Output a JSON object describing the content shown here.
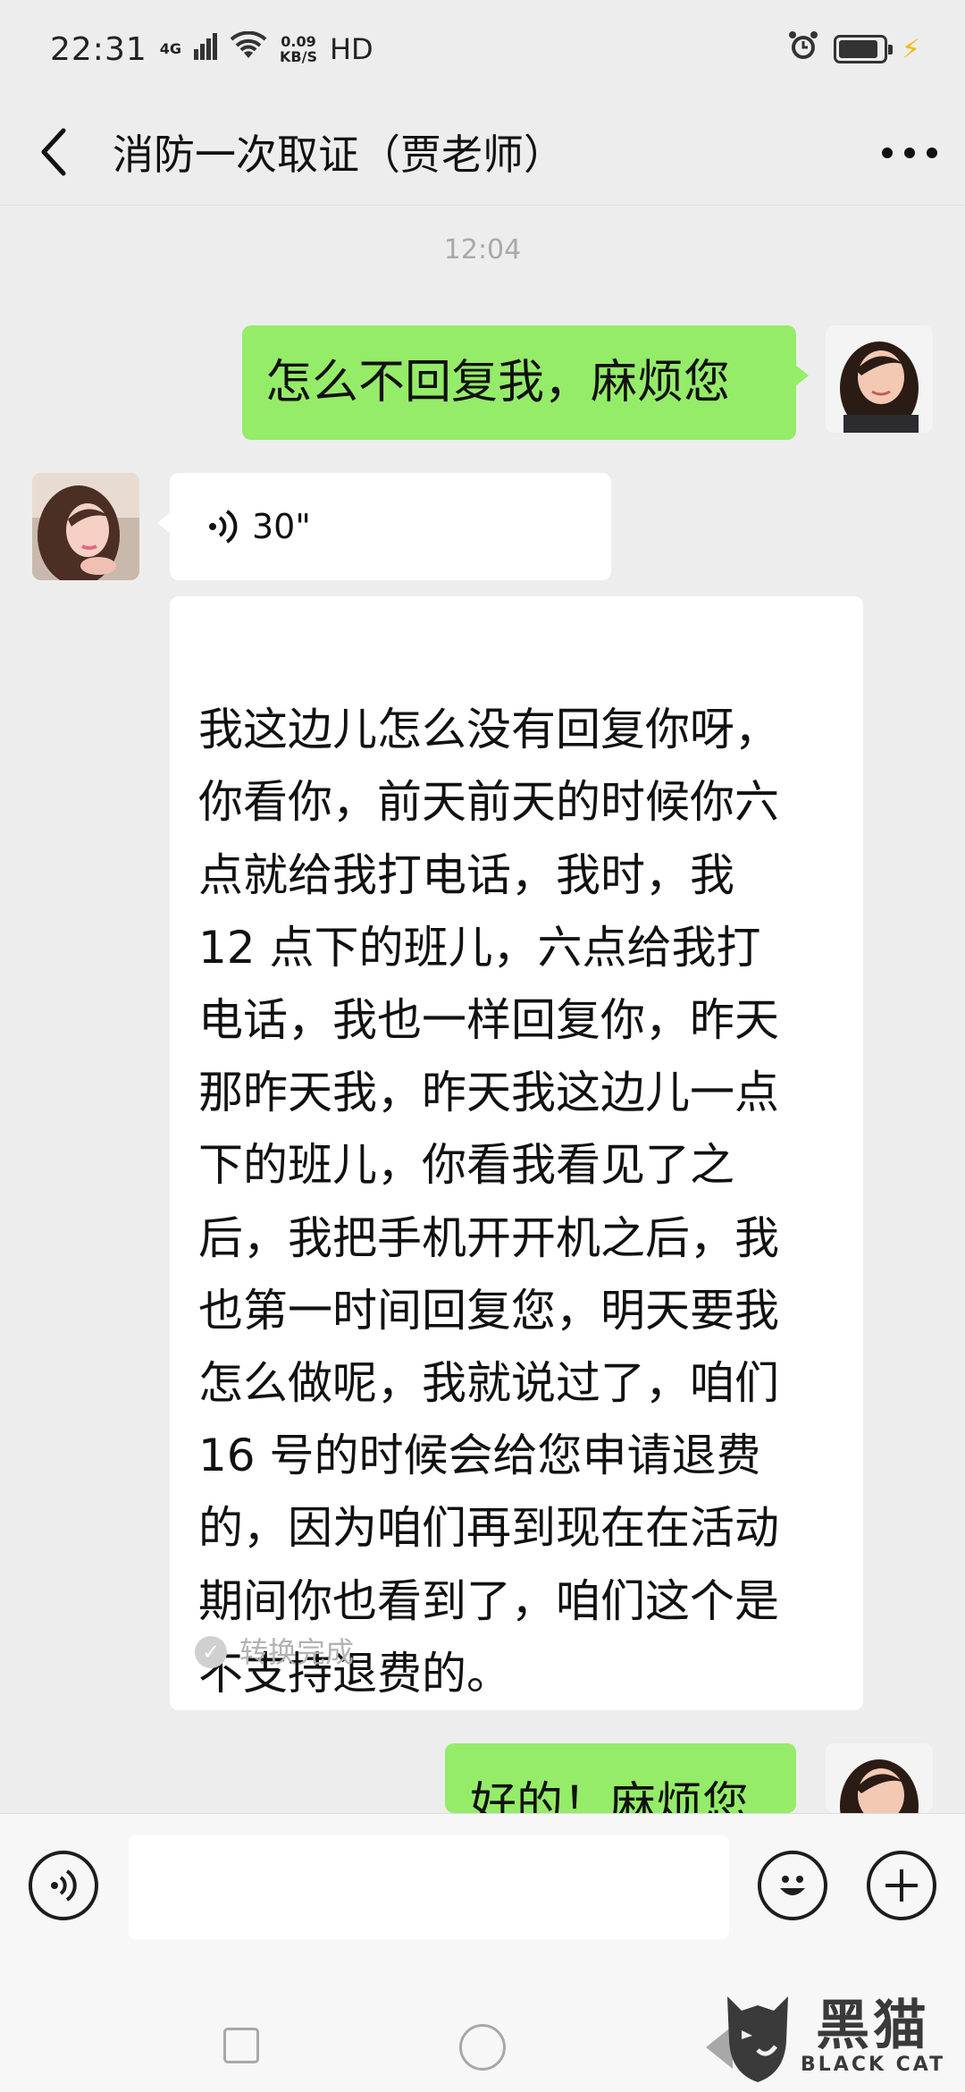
{
  "status_bar": {
    "time": "22:31",
    "network": "4G",
    "speed_value": "0.09",
    "speed_unit": "KB/S",
    "hd": "HD"
  },
  "header": {
    "title": "消防一次取证（贾老师）"
  },
  "chat": {
    "timestamp": "12:04",
    "messages": [
      {
        "side": "self",
        "type": "text",
        "text": "怎么不回复我，麻烦您"
      },
      {
        "side": "other",
        "type": "voice",
        "duration": "30\""
      },
      {
        "side": "other",
        "type": "transcript",
        "text": "我这边儿怎么没有回复你呀，\n你看你，前天前天的时候你六\n点就给我打电话，我时，我\n12 点下的班儿，六点给我打\n电话，我也一样回复你，昨天\n那昨天我，昨天我这边儿一点\n下的班儿，你看我看见了之\n后，我把手机开开机之后，我\n也第一时间回复您，明天要我\n怎么做呢，我就说过了，咱们\n16 号的时候会给您申请退费\n的，因为咱们再到现在在活动\n期间你也看到了，咱们这个是\n不支持退费的。",
        "status": "转换完成"
      },
      {
        "side": "self",
        "type": "text",
        "text": "好的！麻烦您"
      }
    ]
  },
  "input_bar": {
    "placeholder": ""
  },
  "watermark": {
    "cn": "黑猫",
    "en": "BLACK CAT"
  }
}
